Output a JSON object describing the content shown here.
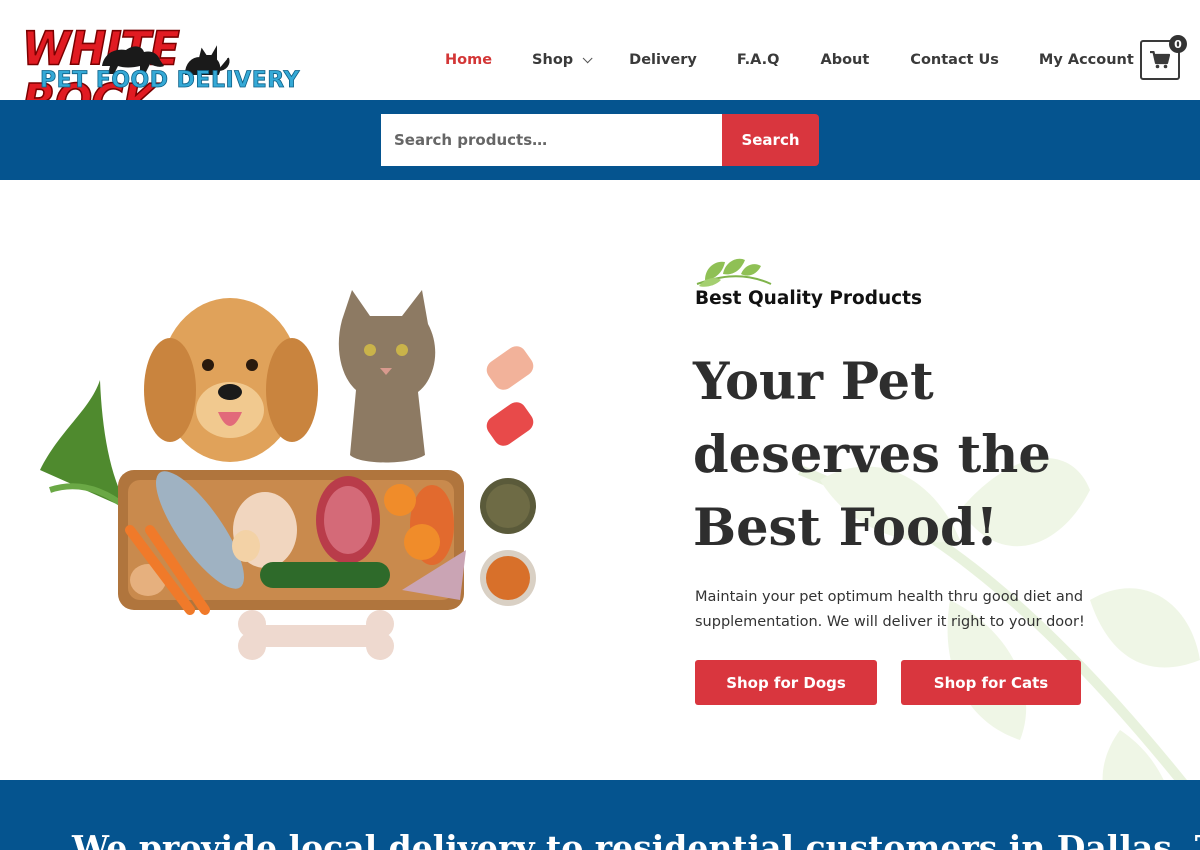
{
  "brand": {
    "logo_line1": "WHITE ROCK",
    "logo_line2": "PET FOOD DELIVERY",
    "colors": {
      "red": "#e11b22",
      "blue": "#35a9d6"
    }
  },
  "nav": {
    "items": [
      {
        "label": "Home",
        "active": true
      },
      {
        "label": "Shop",
        "has_dropdown": true
      },
      {
        "label": "Delivery"
      },
      {
        "label": "F.A.Q"
      },
      {
        "label": "About"
      },
      {
        "label": "Contact Us"
      },
      {
        "label": "My Account"
      }
    ],
    "active_color": "#d33636"
  },
  "cart": {
    "icon": "shopping-cart-icon",
    "count": "0"
  },
  "search": {
    "placeholder": "Search products…",
    "button_label": "Search",
    "band_color": "#05548f",
    "button_color": "#d9363e"
  },
  "hero": {
    "tagline": "Best Quality Products",
    "headline": "Your Pet deserves the Best Food!",
    "subtext": "Maintain your pet optimum health thru good diet and supplementation. We will deliver it right to your door!",
    "buttons": [
      {
        "label": "Shop for Dogs"
      },
      {
        "label": "Shop for Cats"
      }
    ],
    "image_alt_icon": "pets-and-food-illustration"
  },
  "bottom_band": {
    "text": "We provide local delivery to residential customers in Dallas, TX"
  }
}
